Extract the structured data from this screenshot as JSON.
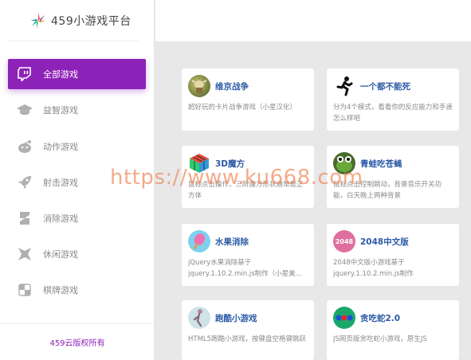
{
  "brand": {
    "title": "459小游戏平台",
    "logo_icon": "star-logo"
  },
  "sidebar": {
    "items": [
      {
        "label": "全部游戏",
        "icon": "twitch-icon",
        "active": true
      },
      {
        "label": "益智游戏",
        "icon": "graduation-cap-icon"
      },
      {
        "label": "动作游戏",
        "icon": "reddit-icon"
      },
      {
        "label": "射击游戏",
        "icon": "rocket-icon"
      },
      {
        "label": "消除游戏",
        "icon": "squares-icon"
      },
      {
        "label": "休闲游戏",
        "icon": "leaf-icon"
      },
      {
        "label": "棋牌游戏",
        "icon": "checker-icon"
      }
    ],
    "footer": "459云版权所有"
  },
  "games": [
    {
      "name": "维京战争",
      "desc": "超好玩的卡片战争游戏（小星汉化）",
      "icon": "viking-thumb-icon"
    },
    {
      "name": "一个都不能死",
      "desc": "分为4个模式，看看你的反应能力和手速怎么样吧",
      "icon": "runner-icon"
    },
    {
      "name": "3D魔方",
      "desc": "鼠标点击操作，三阶魔方形状通常是正方体",
      "icon": "rubiks-cube-icon"
    },
    {
      "name": "青蛙吃苍蝇",
      "desc": "鼠标点击控制跳动，背景音乐开关功能，白天晚上两种背景",
      "icon": "frog-icon"
    },
    {
      "name": "水果消除",
      "desc": "jQuery水果消除基于jquery.1.10.2.min.js制作（小星美...",
      "icon": "popsicle-icon"
    },
    {
      "name": "2048中文版",
      "desc": "2048中文版小游戏基于jquery.1.10.2.min.js制作",
      "icon": "tile-2048-icon",
      "badge": "2048"
    },
    {
      "name": "跑酷小游戏",
      "desc": "HTML5跑酷小游戏，按键盘空格键跳跃",
      "icon": "parkour-icon"
    },
    {
      "name": "贪吃蛇2.0",
      "desc": "JS网页版贪吃蛇小游戏，原生JS",
      "icon": "snake-icon"
    }
  ],
  "watermark": "https://www.ku668.com",
  "colors": {
    "accent": "#8d22b8",
    "title_blue": "#2b5aa6",
    "watermark": "#f08a5d"
  }
}
